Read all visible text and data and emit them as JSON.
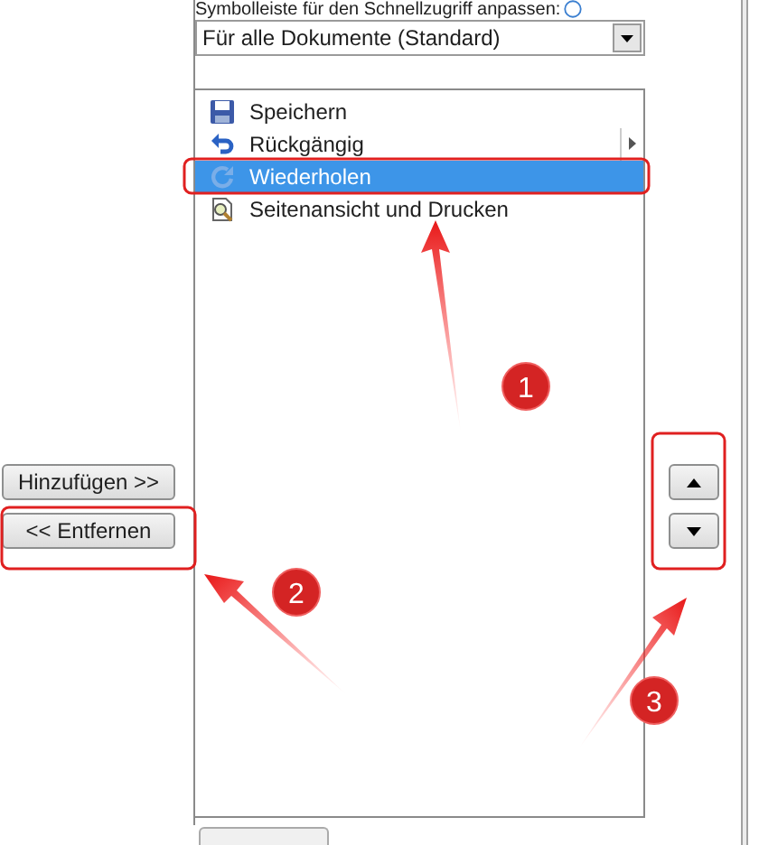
{
  "toolbar_label": {
    "text": "Symbolleiste für den Schnellzugriff anpassen:"
  },
  "scope_dropdown": {
    "value": "Für alle Dokumente (Standard)"
  },
  "commands": [
    {
      "label": "Speichern",
      "selected": false,
      "has_submenu": false
    },
    {
      "label": "Rückgängig",
      "selected": false,
      "has_submenu": true
    },
    {
      "label": "Wiederholen",
      "selected": true,
      "has_submenu": false
    },
    {
      "label": "Seitenansicht und Drucken",
      "selected": false,
      "has_submenu": false
    }
  ],
  "add_button": {
    "label": "Hinzufügen >>"
  },
  "remove_button": {
    "label": "<< Entfernen"
  },
  "annotations": [
    {
      "number": "1"
    },
    {
      "number": "2"
    },
    {
      "number": "3"
    }
  ]
}
